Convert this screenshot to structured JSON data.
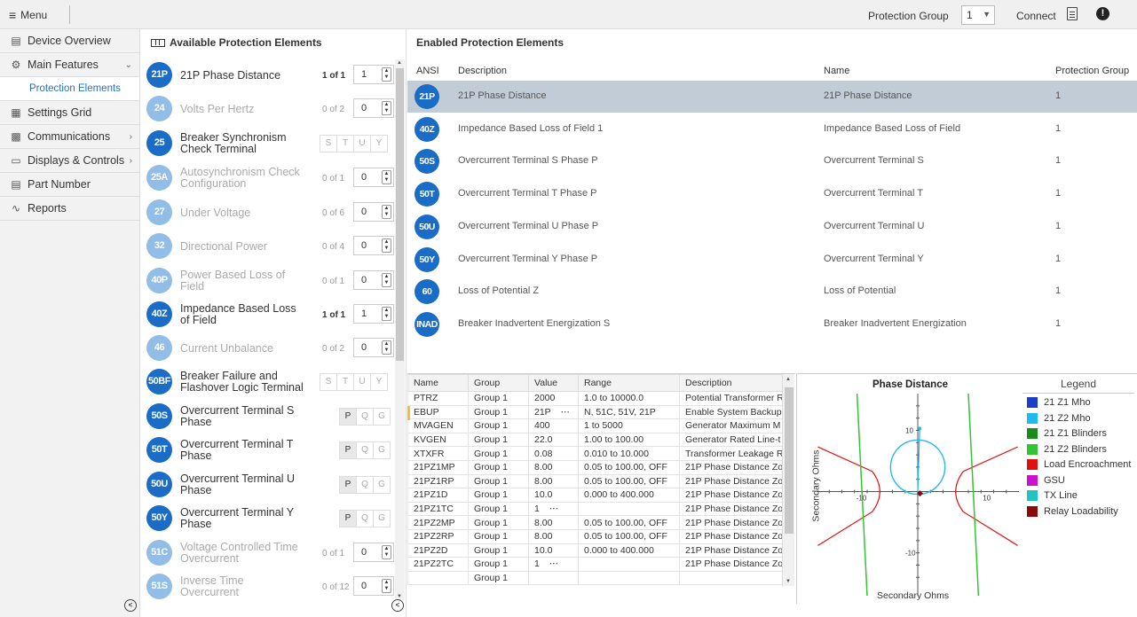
{
  "topbar": {
    "menu_label": "Menu",
    "protection_group_label": "Protection Group",
    "protection_group_value": "1",
    "connect_label": "Connect"
  },
  "sidebar": {
    "items": [
      {
        "label": "Device Overview",
        "icon": "device-icon"
      },
      {
        "label": "Main Features",
        "icon": "gear-icon",
        "expanded": true
      },
      {
        "label": "Protection Elements",
        "sub": true
      },
      {
        "label": "Settings Grid",
        "icon": "grid-icon"
      },
      {
        "label": "Communications",
        "icon": "network-icon"
      },
      {
        "label": "Displays & Controls",
        "icon": "display-icon"
      },
      {
        "label": "Part Number",
        "icon": "list-icon"
      },
      {
        "label": "Reports",
        "icon": "chart-icon"
      }
    ]
  },
  "available": {
    "title": "Available Protection Elements",
    "items": [
      {
        "ansi": "21P",
        "name": "21P Phase Distance",
        "enabled": true,
        "count": "1 of 1",
        "value": "1"
      },
      {
        "ansi": "24",
        "name": "Volts Per Hertz",
        "enabled": false,
        "count": "0 of 2",
        "value": "0"
      },
      {
        "ansi": "25",
        "name": "Breaker Synchronism Check Terminal",
        "enabled": true,
        "terminals": [
          "S",
          "T",
          "U",
          "Y"
        ]
      },
      {
        "ansi": "25A",
        "name": "Autosynchronism Check Configuration",
        "enabled": false,
        "count": "0 of 1",
        "value": "0"
      },
      {
        "ansi": "27",
        "name": "Under Voltage",
        "enabled": false,
        "count": "0 of 6",
        "value": "0"
      },
      {
        "ansi": "32",
        "name": "Directional Power",
        "enabled": false,
        "count": "0 of 4",
        "value": "0"
      },
      {
        "ansi": "40P",
        "name": "Power Based Loss of Field",
        "enabled": false,
        "count": "0 of 1",
        "value": "0"
      },
      {
        "ansi": "40Z",
        "name": "Impedance Based Loss of Field",
        "enabled": true,
        "count": "1 of 1",
        "value": "1"
      },
      {
        "ansi": "46",
        "name": "Current Unbalance",
        "enabled": false,
        "count": "0 of 2",
        "value": "0"
      },
      {
        "ansi": "50BF",
        "name": "Breaker Failure and Flashover Logic Terminal",
        "enabled": true,
        "terminals": [
          "S",
          "T",
          "U",
          "Y"
        ]
      },
      {
        "ansi": "50S",
        "name": "Overcurrent Terminal S Phase",
        "enabled": true,
        "pqg": [
          "P",
          "Q",
          "G"
        ]
      },
      {
        "ansi": "50T",
        "name": "Overcurrent Terminal T Phase",
        "enabled": true,
        "pqg": [
          "P",
          "Q",
          "G"
        ]
      },
      {
        "ansi": "50U",
        "name": "Overcurrent Terminal U Phase",
        "enabled": true,
        "pqg": [
          "P",
          "Q",
          "G"
        ]
      },
      {
        "ansi": "50Y",
        "name": "Overcurrent Terminal Y Phase",
        "enabled": true,
        "pqg": [
          "P",
          "Q",
          "G"
        ]
      },
      {
        "ansi": "51C",
        "name": "Voltage Controlled Time Overcurrent",
        "enabled": false,
        "count": "0 of 1",
        "value": "0"
      },
      {
        "ansi": "51S",
        "name": "Inverse Time Overcurrent",
        "enabled": false,
        "count": "0 of 12",
        "value": "0"
      }
    ]
  },
  "enabled": {
    "title": "Enabled Protection Elements",
    "headers": {
      "ansi": "ANSI",
      "description": "Description",
      "name": "Name",
      "group": "Protection Group"
    },
    "rows": [
      {
        "ansi": "21P",
        "description": "21P Phase Distance",
        "name": "21P Phase Distance",
        "group": "1",
        "selected": true
      },
      {
        "ansi": "40Z",
        "description": "Impedance Based Loss of Field 1",
        "name": "Impedance Based Loss of Field",
        "group": "1"
      },
      {
        "ansi": "50S",
        "description": "Overcurrent Terminal S Phase P",
        "name": "Overcurrent Terminal S",
        "group": "1"
      },
      {
        "ansi": "50T",
        "description": "Overcurrent Terminal T Phase P",
        "name": "Overcurrent Terminal T",
        "group": "1"
      },
      {
        "ansi": "50U",
        "description": "Overcurrent Terminal U Phase P",
        "name": "Overcurrent Terminal U",
        "group": "1"
      },
      {
        "ansi": "50Y",
        "description": "Overcurrent Terminal Y Phase P",
        "name": "Overcurrent Terminal Y",
        "group": "1"
      },
      {
        "ansi": "60",
        "description": "Loss of Potential Z",
        "name": "Loss of Potential",
        "group": "1"
      },
      {
        "ansi": "INAD",
        "description": "Breaker Inadvertent Energization S",
        "name": "Breaker Inadvertent Energization",
        "group": "1"
      }
    ]
  },
  "settings": {
    "headers": [
      "Name",
      "Group",
      "Value",
      "Range",
      "Description"
    ],
    "rows": [
      [
        "PTRZ",
        "Group 1",
        "2000",
        "1.0 to 10000.0",
        "Potential Transformer R"
      ],
      [
        "EBUP",
        "Group 1",
        "21P",
        "N, 51C, 51V, 21P",
        "Enable System Backup"
      ],
      [
        "MVAGEN",
        "Group 1",
        "400",
        "1 to 5000",
        "Generator Maximum M"
      ],
      [
        "KVGEN",
        "Group 1",
        "22.0",
        "1.00 to 100.00",
        "Generator Rated Line-t"
      ],
      [
        "XTXFR",
        "Group 1",
        "0.08",
        "0.010 to 10.000",
        "Transformer Leakage R"
      ],
      [
        "21PZ1MP",
        "Group 1",
        "8.00",
        "0.05 to 100.00, OFF",
        "21P Phase Distance Zo"
      ],
      [
        "21PZ1RP",
        "Group 1",
        "8.00",
        "0.05 to 100.00, OFF",
        "21P Phase Distance Zo"
      ],
      [
        "21PZ1D",
        "Group 1",
        "10.0",
        "0.000 to 400.000",
        "21P Phase Distance Zo"
      ],
      [
        "21PZ1TC",
        "Group 1",
        "1",
        "",
        "21P Phase Distance Zo"
      ],
      [
        "21PZ2MP",
        "Group 1",
        "8.00",
        "0.05 to 100.00, OFF",
        "21P Phase Distance Zo"
      ],
      [
        "21PZ2RP",
        "Group 1",
        "8.00",
        "0.05 to 100.00, OFF",
        "21P Phase Distance Zo"
      ],
      [
        "21PZ2D",
        "Group 1",
        "10.0",
        "0.000 to 400.000",
        "21P Phase Distance Zo"
      ],
      [
        "21PZ2TC",
        "Group 1",
        "1",
        "",
        "21P Phase Distance Zo"
      ],
      [
        "",
        "Group 1",
        "",
        "",
        ""
      ]
    ]
  },
  "chart_data": {
    "type": "scatter",
    "title": "Phase Distance",
    "xlabel": "Secondary Ohms",
    "ylabel": "Secondary Ohms",
    "xlim": [
      -16,
      16
    ],
    "ylim": [
      -17,
      16
    ],
    "xticks": [
      -10,
      10
    ],
    "yticks": [
      10,
      -10
    ],
    "series": [
      {
        "name": "21 Z1 Mho",
        "color": "#1a3ec8"
      },
      {
        "name": "21 Z2 Mho",
        "color": "#22b8f0"
      },
      {
        "name": "21 Z1 Blinders",
        "color": "#1a8a1a"
      },
      {
        "name": "21 Z2 Blinders",
        "color": "#33c433"
      },
      {
        "name": "Load Encroachment",
        "color": "#e01010"
      },
      {
        "name": "GSU",
        "color": "#cc10cc"
      },
      {
        "name": "TX Line",
        "color": "#20c4c4"
      },
      {
        "name": "Relay Loadability",
        "color": "#8a0a0a"
      }
    ],
    "legend_title": "Legend",
    "legend_position": "right"
  }
}
